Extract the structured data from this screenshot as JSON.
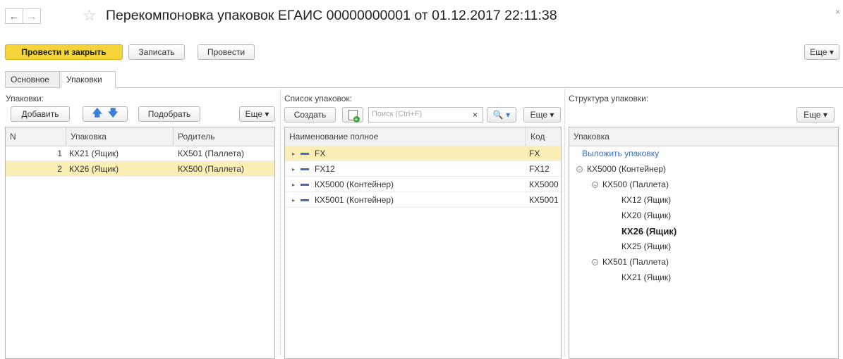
{
  "title": "Перекомпоновка упаковок ЕГАИС 00000000001 от 01.12.2017 22:11:38",
  "nav": {
    "back": "←",
    "forward": "→",
    "star": "☆"
  },
  "toolbar": {
    "post_close": "Провести и закрыть",
    "save": "Записать",
    "post": "Провести",
    "more": "Еще ▾"
  },
  "tabs": [
    "Основное",
    "Упаковки"
  ],
  "packages": {
    "label": "Упаковки:",
    "add": "Добавить",
    "pick": "Подобрать",
    "more": "Еще ▾",
    "columns": [
      "N",
      "Упаковка",
      "Родитель"
    ],
    "rows": [
      {
        "n": "1",
        "package": "КХ21 (Ящик)",
        "parent": "КХ501 (Паллета)"
      },
      {
        "n": "2",
        "package": "КХ26 (Ящик)",
        "parent": "КХ500 (Паллета)"
      }
    ]
  },
  "list": {
    "label": "Список упаковок:",
    "create": "Создать",
    "search_placeholder": "Поиск (Ctrl+F)",
    "clear": "×",
    "search_btn": "🔍 ▾",
    "more": "Еще ▾",
    "columns": [
      "Наименование полное",
      "Код"
    ],
    "rows": [
      {
        "name": "FX",
        "code": "FX"
      },
      {
        "name": "FX12",
        "code": "FX12"
      },
      {
        "name": "КХ5000 (Контейнер)",
        "code": "КХ5000"
      },
      {
        "name": "КХ5001 (Контейнер)",
        "code": "КХ5001"
      }
    ]
  },
  "structure": {
    "label": "Структура упаковки:",
    "more": "Еще ▾",
    "column": "Упаковка",
    "link": "Выложить упаковку",
    "tree": [
      {
        "text": "КХ5000 (Контейнер)",
        "level": 0,
        "expander": true
      },
      {
        "text": "КХ500 (Паллета)",
        "level": 1,
        "expander": true
      },
      {
        "text": "КХ12 (Ящик)",
        "level": 2
      },
      {
        "text": "КХ20 (Ящик)",
        "level": 2
      },
      {
        "text": "КХ26 (Ящик)",
        "level": 2,
        "bold": true
      },
      {
        "text": "КХ25 (Ящик)",
        "level": 2
      },
      {
        "text": "КХ501 (Паллета)",
        "level": 1,
        "expander": true
      },
      {
        "text": "КХ21 (Ящик)",
        "level": 2
      }
    ]
  },
  "colors": {
    "accent": "#f5d33a",
    "selected_row": "#fbeeb7",
    "link": "#3b6fb6",
    "arrow": "#3a7fd6"
  }
}
